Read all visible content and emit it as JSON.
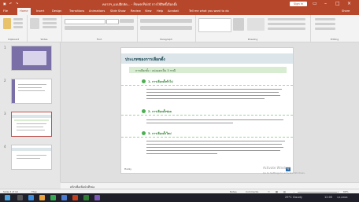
{
  "window": {
    "title": "คลาสฯ_แบบฝึกหัด... - PowerPoint การใช้สิทธิ์เลือกตั้ง",
    "sign_in": "Sign in",
    "share": "Share"
  },
  "tabs": [
    "File",
    "Home",
    "Insert",
    "Design",
    "Transitions",
    "Animations",
    "Slide Show",
    "Review",
    "View",
    "Help",
    "Acrobat",
    "Tell me what you want to do"
  ],
  "ribbon_groups": [
    "Clipboard",
    "Slides",
    "Font",
    "Paragraph",
    "Drawing",
    "Editing"
  ],
  "thumbnails": [
    {
      "num": "1"
    },
    {
      "num": "2"
    },
    {
      "num": "3"
    },
    {
      "num": "4"
    }
  ],
  "slide": {
    "header": "ประเภทของการเลือกตั้ง",
    "subheader": "การเลือกตั้ง : แบ่งออกเป็น 3 กรณี",
    "sections": [
      "1. การเลือกตั้งทั่วไป",
      "2. การเลือกตั้งซ่อม",
      "3. การเลือกตั้งใหม่"
    ],
    "logo_text": "Hozzy",
    "page_number": "3"
  },
  "notes_placeholder": "คลิกเพื่อเพิ่มบันทึกย่อ",
  "status": {
    "slide_info": "Slide 3 of 10",
    "language": "Thai",
    "notes": "Notes",
    "comments": "Comments",
    "zoom": "66%"
  },
  "activate": {
    "title": "Activate Windows",
    "subtitle": "Go to Settings to activate Windows."
  },
  "taskbar": {
    "weather": "29°C Cloudy",
    "time": "12:00",
    "date": "1/1/2024"
  }
}
